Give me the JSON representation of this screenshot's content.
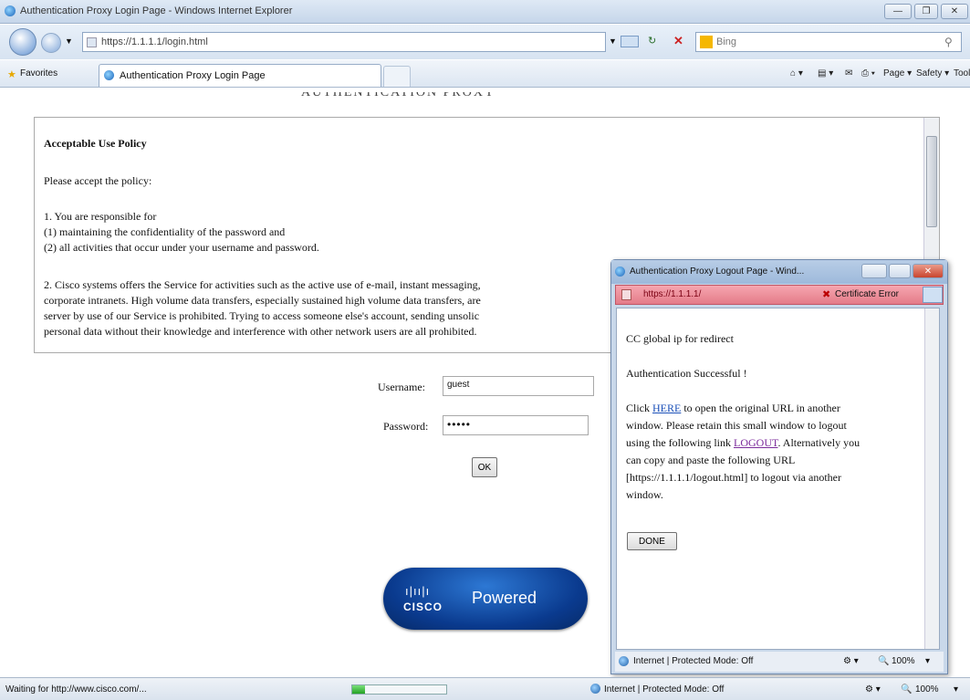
{
  "window": {
    "title": "Authentication Proxy Login Page - Windows Internet Explorer",
    "min_label": "—",
    "max_label": "❐",
    "close_label": "✕"
  },
  "address_bar": {
    "url": "https://1.1.1.1/login.html",
    "search_engine": "Bing",
    "search_placeholder": "Bing"
  },
  "favorites_bar": {
    "favorites_label": "Favorites",
    "tab_title": "Authentication Proxy Login Page",
    "commands": [
      "Page ▾",
      "Safety ▾",
      "Tools ▾"
    ]
  },
  "policy": {
    "heading": "Acceptable Use Policy",
    "intro": "Please accept the policy:",
    "item1": "1. You are responsible for",
    "item1a": "(1) maintaining the confidentiality of the password and",
    "item1b": "(2) all activities that occur under your username and password.",
    "item2_l1": "2. Cisco systems offers the Service for activities such as the active use of e-mail, instant messaging,",
    "item2_l2": "corporate intranets. High volume data transfers, especially sustained high volume data transfers, are",
    "item2_l3": "server by use of our Service is prohibited. Trying to access someone else's account, sending unsolic",
    "item2_l4": "personal data without their knowledge and interference with other network users are all prohibited."
  },
  "login": {
    "username_label": "Username:",
    "username_value": "guest",
    "password_label": "Password:",
    "password_value": "•••••",
    "ok_label": "OK"
  },
  "cisco_logo": {
    "bars": "ı|ıı|ı",
    "brand": "CISCO",
    "powered": "Powered"
  },
  "popup": {
    "title": "Authentication Proxy Logout Page - Wind...",
    "url": "https://1.1.1.1/",
    "cert_error": "Certificate Error",
    "line_redirect": "CC global ip for redirect",
    "line_success": "Authentication Successful !",
    "click_prefix": "Click ",
    "here_link": "HERE",
    "click_suffix": " to open the original URL in another",
    "line_window": "window. Please retain this small window to logout",
    "line_using_prefix": "using the following link ",
    "logout_link": "LOGOUT",
    "line_using_suffix": ". Alternatively you",
    "line_copy": "can copy and paste the following URL",
    "line_url": "[https://1.1.1.1/logout.html] to logout via another",
    "line_window2": "window.",
    "done_label": "DONE",
    "status_text": "Internet | Protected Mode: Off",
    "zoom": "100%"
  },
  "status_bar": {
    "text": "Waiting for http://www.cisco.com/...",
    "zone": "Internet | Protected Mode: Off",
    "zoom": "100%"
  }
}
